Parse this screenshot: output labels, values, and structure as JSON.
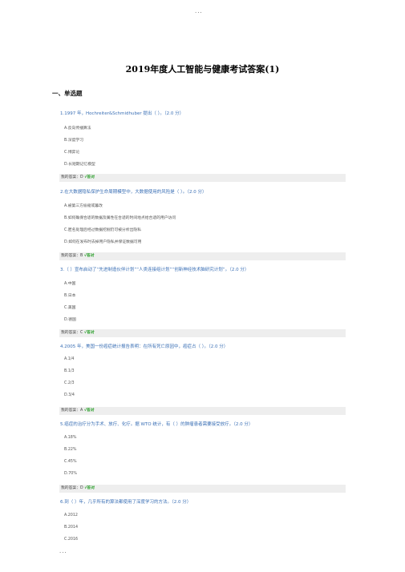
{
  "header_dots": "···",
  "footer_dots": "···",
  "title": "2019年度人工智能与健康考试答案(1)",
  "section": "一、单选题",
  "questions": [
    {
      "text": "1.1997 年，Hochreiter&Schmidhuber 提出（ ）。（2.0 分）",
      "options": [
        "A.反向传播算法",
        "B.深度学习",
        "C.博弈论",
        "D.长短期记忆模型"
      ],
      "answer_prefix": "我的答案：D",
      "answer_mark": "√答对"
    },
    {
      "text": "2.在大数据隐私保护生命周期模型中，大数据使用的风险是（ ）。（2.0 分）",
      "options": [
        "A.被第三方偷窥或篡改",
        "B.如何确保合适的数据及属性在合适的时间地点给合适的用户访问",
        "C.匿名处理后经过数据挖掘仍可被分析出隐私",
        "D.如何在发布时去掉用户隐私并保证数据可用"
      ],
      "answer_prefix": "我的答案：B",
      "answer_mark": "√答对"
    },
    {
      "text": "3.（ ）宣布启动了“先进制造伙伴计划”“人类连接组计划”“创新神经技术脑研究计划”。（2.0 分）",
      "options": [
        "A.中国",
        "B.日本",
        "C.美国",
        "D.德国"
      ],
      "answer_prefix": "我的答案：C",
      "answer_mark": "√答对"
    },
    {
      "text": "4.2005 年，美国一份癌症统计报告表明：在所有死亡原因中，癌症占（ ）。（2.0 分）",
      "options": [
        "A.1/4",
        "B.1/3",
        "C.2/3",
        "D.3/4"
      ],
      "answer_prefix": "我的答案：A",
      "answer_mark": "√答对"
    },
    {
      "text": "5.癌症的治疗分为手术、放疗、化疗。据 WTO 统计，有（ ）的肿瘤患者需要接受放疗。（2.0 分）",
      "options": [
        "A.18%",
        "B.22%",
        "C.45%",
        "D.70%"
      ],
      "answer_prefix": "我的答案：D",
      "answer_mark": "√答对"
    },
    {
      "text": "6.到（ ）年，几乎所有的算法都使用了深度学习的方法。（2.0 分）",
      "options": [
        "A.2012",
        "B.2014",
        "C.2016"
      ]
    }
  ]
}
